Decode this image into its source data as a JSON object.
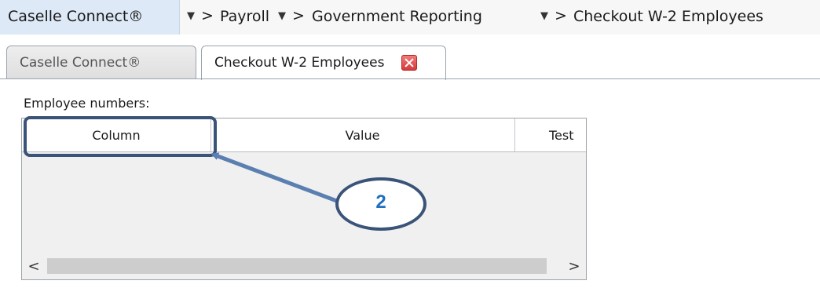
{
  "breadcrumb": {
    "home": "Caselle Connect®",
    "separator": ">",
    "items": [
      "Payroll",
      "Government Reporting",
      "Checkout W-2 Employees"
    ]
  },
  "tabs": [
    {
      "label": "Caselle Connect®",
      "active": false
    },
    {
      "label": "Checkout W-2 Employees",
      "active": true
    }
  ],
  "panel": {
    "section_label": "Employee numbers:",
    "columns": [
      "Column",
      "Value",
      "Test"
    ],
    "scroll_left": "<",
    "scroll_right": ">"
  },
  "annotation": {
    "callout_number": "2",
    "color": "#3a5378",
    "number_color": "#1f70bf"
  }
}
